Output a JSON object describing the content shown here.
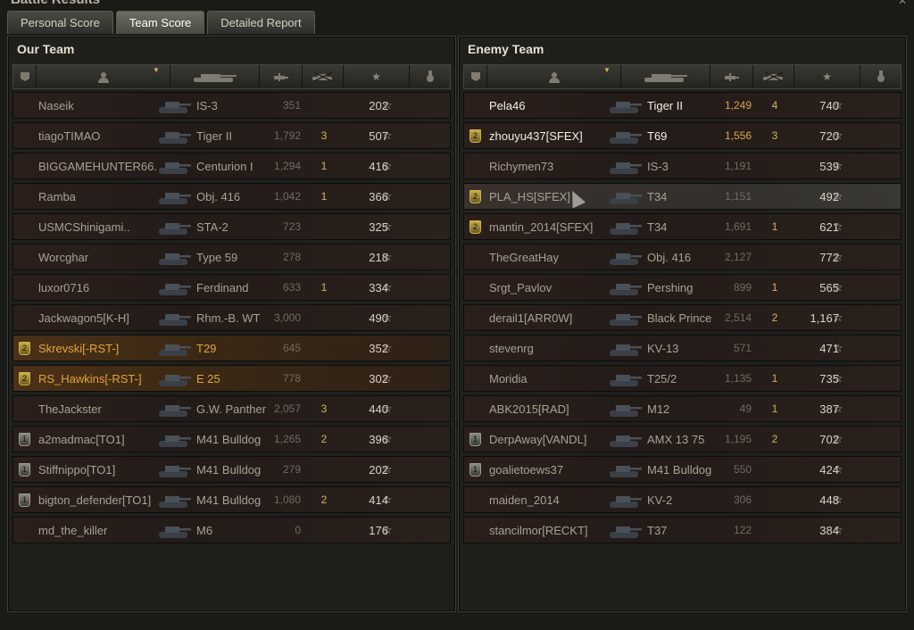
{
  "window": {
    "title": "Battle Results"
  },
  "tabs": [
    {
      "label": "Personal Score",
      "active": false
    },
    {
      "label": "Team Score",
      "active": true
    },
    {
      "label": "Detailed Report",
      "active": false
    }
  ],
  "icons": {
    "col_badge": "platoon-icon",
    "col_player": "player-icon",
    "col_tank": "tank-icon",
    "col_damage": "damage-icon",
    "col_kills": "destroyed-tank-icon",
    "col_xp": "star-icon",
    "col_medal": "medal-icon"
  },
  "colors": {
    "squad_highlight": "#e0a53e",
    "kills": "#d8b15c",
    "damage_bright": "#d9a54b"
  },
  "our_team": {
    "title": "Our Team",
    "rows": [
      {
        "badge": "",
        "name": "Naseik",
        "tank": "IS-3",
        "damage": "351",
        "kills": "",
        "xp": "202",
        "style": ""
      },
      {
        "badge": "",
        "name": "tiagoTIMAO",
        "tank": "Tiger II",
        "damage": "1,792",
        "kills": "3",
        "xp": "507",
        "style": ""
      },
      {
        "badge": "",
        "name": "BIGGAMEHUNTER66..",
        "tank": "Centurion I",
        "damage": "1,294",
        "kills": "1",
        "xp": "416",
        "style": ""
      },
      {
        "badge": "",
        "name": "Ramba",
        "tank": "Obj. 416",
        "damage": "1,042",
        "kills": "1",
        "xp": "366",
        "style": ""
      },
      {
        "badge": "",
        "name": "USMCShinigami..",
        "tank": "STA-2",
        "damage": "723",
        "kills": "",
        "xp": "325",
        "style": ""
      },
      {
        "badge": "",
        "name": "Worcghar",
        "tank": "Type 59",
        "damage": "278",
        "kills": "",
        "xp": "218",
        "style": ""
      },
      {
        "badge": "",
        "name": "luxor0716",
        "tank": "Ferdinand",
        "damage": "633",
        "kills": "1",
        "xp": "334",
        "style": ""
      },
      {
        "badge": "",
        "name": "Jackwagon5[K-H]",
        "tank": "Rhm.-B. WT",
        "damage": "3,000",
        "kills": "",
        "xp": "490",
        "style": ""
      },
      {
        "badge": "2",
        "name": "Skrevski[-RST-]",
        "tank": "T29",
        "damage": "645",
        "kills": "",
        "xp": "352",
        "style": "squad"
      },
      {
        "badge": "2",
        "name": "RS_Hawkins[-RST-]",
        "tank": "E 25",
        "damage": "778",
        "kills": "",
        "xp": "302",
        "style": "squad"
      },
      {
        "badge": "",
        "name": "TheJackster",
        "tank": "G.W. Panther",
        "damage": "2,057",
        "kills": "3",
        "xp": "440",
        "style": ""
      },
      {
        "badge": "1",
        "name": "a2madmac[TO1]",
        "tank": "M41 Bulldog",
        "damage": "1,265",
        "kills": "2",
        "xp": "396",
        "style": ""
      },
      {
        "badge": "1",
        "name": "Stiffnippo[TO1]",
        "tank": "M41 Bulldog",
        "damage": "279",
        "kills": "",
        "xp": "202",
        "style": ""
      },
      {
        "badge": "1",
        "name": "bigton_defender[TO1]",
        "tank": "M41 Bulldog",
        "damage": "1,080",
        "kills": "2",
        "xp": "414",
        "style": ""
      },
      {
        "badge": "",
        "name": "md_the_killer",
        "tank": "M6",
        "damage": "0",
        "kills": "",
        "xp": "176",
        "style": ""
      }
    ]
  },
  "enemy_team": {
    "title": "Enemy Team",
    "rows": [
      {
        "badge": "",
        "name": "Pela46",
        "tank": "Tiger II",
        "damage": "1,249",
        "kills": "4",
        "xp": "740",
        "style": "bright"
      },
      {
        "badge": "2",
        "name": "zhouyu437[SFEX]",
        "tank": "T69",
        "damage": "1,556",
        "kills": "3",
        "xp": "720",
        "style": "bright"
      },
      {
        "badge": "",
        "name": "Richymen73",
        "tank": "IS-3",
        "damage": "1,191",
        "kills": "",
        "xp": "539",
        "style": ""
      },
      {
        "badge": "2",
        "name": "PLA_HS[SFEX]",
        "tank": "T34",
        "damage": "1,151",
        "kills": "",
        "xp": "492",
        "style": "hover"
      },
      {
        "badge": "2",
        "name": "mantin_2014[SFEX]",
        "tank": "T34",
        "damage": "1,691",
        "kills": "1",
        "xp": "621",
        "style": ""
      },
      {
        "badge": "",
        "name": "TheGreatHay",
        "tank": "Obj. 416",
        "damage": "2,127",
        "kills": "",
        "xp": "772",
        "style": ""
      },
      {
        "badge": "",
        "name": "Srgt_Pavlov",
        "tank": "Pershing",
        "damage": "899",
        "kills": "1",
        "xp": "565",
        "style": ""
      },
      {
        "badge": "",
        "name": "derail1[ARR0W]",
        "tank": "Black Prince",
        "damage": "2,514",
        "kills": "2",
        "xp": "1,167",
        "style": ""
      },
      {
        "badge": "",
        "name": "stevenrg",
        "tank": "KV-13",
        "damage": "571",
        "kills": "",
        "xp": "471",
        "style": ""
      },
      {
        "badge": "",
        "name": "Moridia",
        "tank": "T25/2",
        "damage": "1,135",
        "kills": "1",
        "xp": "735",
        "style": ""
      },
      {
        "badge": "",
        "name": "ABK2015[RAD]",
        "tank": "M12",
        "damage": "49",
        "kills": "1",
        "xp": "387",
        "style": ""
      },
      {
        "badge": "1",
        "name": "DerpAway[VANDL]",
        "tank": "AMX 13 75",
        "damage": "1,195",
        "kills": "2",
        "xp": "702",
        "style": ""
      },
      {
        "badge": "1",
        "name": "goalietoews37",
        "tank": "M41 Bulldog",
        "damage": "550",
        "kills": "",
        "xp": "424",
        "style": ""
      },
      {
        "badge": "",
        "name": "maiden_2014",
        "tank": "KV-2",
        "damage": "306",
        "kills": "",
        "xp": "448",
        "style": ""
      },
      {
        "badge": "",
        "name": "stancilmor[RECKT]",
        "tank": "T37",
        "damage": "122",
        "kills": "",
        "xp": "384",
        "style": ""
      }
    ]
  }
}
